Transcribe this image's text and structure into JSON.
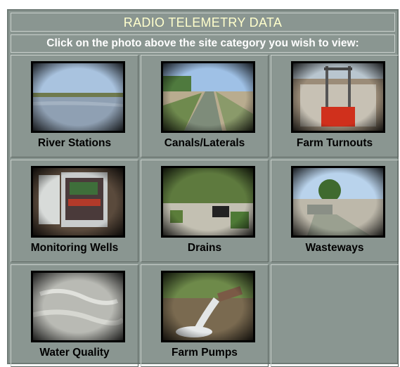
{
  "header": {
    "title": "RADIO TELEMETRY DATA",
    "instruction": "Click on the photo above the site category you wish to view:"
  },
  "colors": {
    "panel_bg": "#8a9691",
    "title_text": "#ffffcc",
    "subtitle_text": "#ffffff"
  },
  "categories": [
    {
      "label": "River Stations"
    },
    {
      "label": "Canals/Laterals"
    },
    {
      "label": "Farm Turnouts"
    },
    {
      "label": "Monitoring Wells"
    },
    {
      "label": "Drains"
    },
    {
      "label": "Wasteways"
    },
    {
      "label": "Water Quality"
    },
    {
      "label": "Farm Pumps"
    }
  ]
}
